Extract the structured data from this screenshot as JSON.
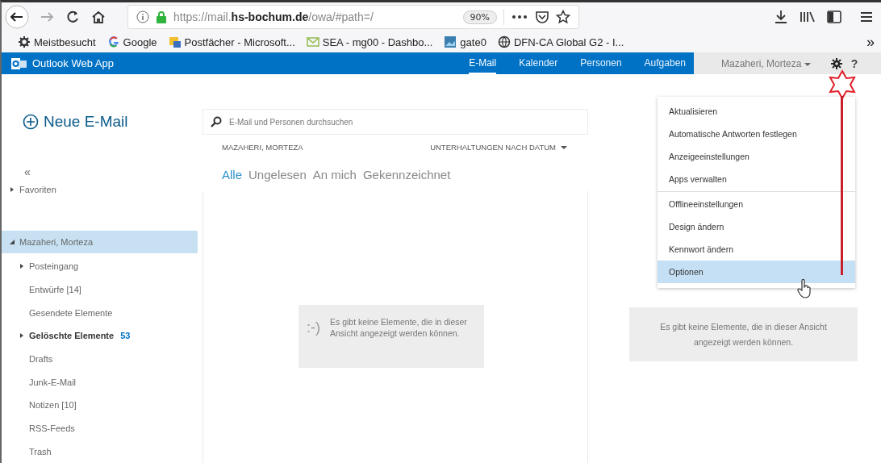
{
  "browser": {
    "url": "https://mail.**hs-bochum.de**/owa/#path=/",
    "zoom": "90%",
    "bookmarks": [
      {
        "kind": "gear",
        "label": "Meistbesucht"
      },
      {
        "kind": "google",
        "label": "Google"
      },
      {
        "kind": "folder",
        "label": "Postfächer - Microsoft..."
      },
      {
        "kind": "mail",
        "label": "SEA - mg00 - Dashbo..."
      },
      {
        "kind": "image",
        "label": "gate0"
      },
      {
        "kind": "globe",
        "label": "DFN-CA Global G2 - I..."
      }
    ],
    "overflow": "»"
  },
  "app": {
    "title": "Outlook Web App",
    "nav": [
      {
        "label": "E-Mail",
        "selected": true
      },
      {
        "label": "Kalender",
        "selected": false
      },
      {
        "label": "Personen",
        "selected": false
      },
      {
        "label": "Aufgaben",
        "selected": false
      }
    ],
    "user": "Mazaheri, Morteza",
    "help": "?"
  },
  "sidebar": {
    "new_mail": "Neue E-Mail",
    "collapse": "«",
    "folders": [
      {
        "label": "Favoriten",
        "expanded": false,
        "selected": false
      },
      {
        "label": "Mazaheri, Morteza",
        "expanded": true,
        "selected": true,
        "children": [
          {
            "label": "Posteingang",
            "expandable": true,
            "bold": false
          },
          {
            "label": "Entwürfe [14]",
            "expandable": false,
            "bold": false
          },
          {
            "label": "Gesendete Elemente",
            "expandable": false,
            "bold": false
          },
          {
            "label": "Gelöschte Elemente",
            "expandable": true,
            "bold": true,
            "count": "53"
          },
          {
            "label": "Drafts",
            "expandable": false,
            "bold": false
          },
          {
            "label": "Junk-E-Mail",
            "expandable": false,
            "bold": false
          },
          {
            "label": "Notizen [10]",
            "expandable": false,
            "bold": false
          },
          {
            "label": "RSS-Feeds",
            "expandable": false,
            "bold": false
          },
          {
            "label": "Trash",
            "expandable": false,
            "bold": false
          }
        ]
      }
    ]
  },
  "mail_list": {
    "search": {
      "placeholder": "E-Mail und Personen durchsuchen"
    },
    "owner": "MAZAHERI, MORTEZA",
    "sort": "UNTERHALTUNGEN NACH DATUM",
    "filters": [
      {
        "label": "Alle",
        "selected": true
      },
      {
        "label": "Ungelesen",
        "selected": false
      },
      {
        "label": "An mich",
        "selected": false
      },
      {
        "label": "Gekennzeichnet",
        "selected": false
      }
    ],
    "empty_icon": ":-)",
    "empty_message": "Es gibt keine Elemente, die in dieser Ansicht angezeigt werden können."
  },
  "reading_pane": {
    "empty_message": "Es gibt keine Elemente, die in dieser Ansicht angezeigt werden können."
  },
  "settings_menu": {
    "groups": [
      [
        {
          "label": "Aktualisieren",
          "selected": false
        },
        {
          "label": "Automatische Antworten festlegen",
          "selected": false
        },
        {
          "label": "Anzeigeeinstellungen",
          "selected": false
        },
        {
          "label": "Apps verwalten",
          "selected": false
        }
      ],
      [
        {
          "label": "Offlineeinstellungen",
          "selected": false
        },
        {
          "label": "Design ändern",
          "selected": false
        },
        {
          "label": "Kennwort ändern",
          "selected": false
        },
        {
          "label": "Optionen",
          "selected": true
        }
      ]
    ]
  }
}
